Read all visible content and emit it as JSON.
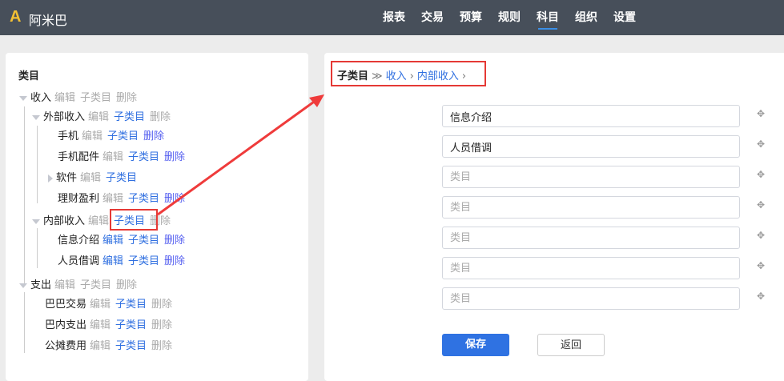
{
  "header": {
    "logo": "A",
    "brand": "阿米巴",
    "nav": [
      "报表",
      "交易",
      "预算",
      "规则",
      "科目",
      "组织",
      "设置"
    ],
    "active": "科目"
  },
  "left": {
    "title": "类目",
    "rows": [
      {
        "name": "收入",
        "level": 0,
        "toggle": "down",
        "actions": [
          [
            "编辑",
            "g"
          ],
          [
            "子类目",
            "g"
          ],
          [
            "删除",
            "g"
          ]
        ]
      },
      {
        "name": "外部收入",
        "level": 1,
        "toggle": "down",
        "actions": [
          [
            "编辑",
            "g"
          ],
          [
            "子类目",
            "b"
          ],
          [
            "删除",
            "g"
          ]
        ]
      },
      {
        "name": "手机",
        "level": 2,
        "actions": [
          [
            "编辑",
            "g"
          ],
          [
            "子类目",
            "b"
          ],
          [
            "删除",
            "p"
          ]
        ]
      },
      {
        "name": "手机配件",
        "level": 2,
        "actions": [
          [
            "编辑",
            "g"
          ],
          [
            "子类目",
            "b"
          ],
          [
            "删除",
            "p"
          ]
        ]
      },
      {
        "name": "软件",
        "level": 2,
        "toggle": "right",
        "actions": [
          [
            "编辑",
            "g"
          ],
          [
            "子类目",
            "b"
          ]
        ]
      },
      {
        "name": "理财盈利",
        "level": 2,
        "actions": [
          [
            "编辑",
            "g"
          ],
          [
            "子类目",
            "b"
          ],
          [
            "删除",
            "p"
          ]
        ]
      },
      {
        "name": "内部收入",
        "level": 1,
        "toggle": "down",
        "actions": [
          [
            "编辑",
            "g"
          ],
          [
            "子类目",
            "b"
          ],
          [
            "删除",
            "g"
          ]
        ]
      },
      {
        "name": "信息介绍",
        "level": 2,
        "actions": [
          [
            "编辑",
            "b"
          ],
          [
            "子类目",
            "b"
          ],
          [
            "删除",
            "p"
          ]
        ]
      },
      {
        "name": "人员借调",
        "level": 2,
        "actions": [
          [
            "编辑",
            "b"
          ],
          [
            "子类目",
            "b"
          ],
          [
            "删除",
            "p"
          ]
        ]
      },
      {
        "name": "支出",
        "level": 0,
        "toggle": "down",
        "actions": [
          [
            "编辑",
            "g"
          ],
          [
            "子类目",
            "g"
          ],
          [
            "删除",
            "g"
          ]
        ]
      },
      {
        "name": "巴巴交易",
        "level": 1,
        "actions": [
          [
            "编辑",
            "g"
          ],
          [
            "子类目",
            "b"
          ],
          [
            "删除",
            "g"
          ]
        ]
      },
      {
        "name": "巴内支出",
        "level": 1,
        "actions": [
          [
            "编辑",
            "g"
          ],
          [
            "子类目",
            "b"
          ],
          [
            "删除",
            "g"
          ]
        ]
      },
      {
        "name": "公摊费用",
        "level": 1,
        "actions": [
          [
            "编辑",
            "g"
          ],
          [
            "子类目",
            "b"
          ],
          [
            "删除",
            "g"
          ]
        ]
      }
    ]
  },
  "right": {
    "breadcrumb": {
      "title": "子类目",
      "sep": "≫",
      "items": [
        "收入",
        "内部收入"
      ],
      "chev": "›"
    },
    "inputs": [
      {
        "value": "信息介绍",
        "placeholder": "类目"
      },
      {
        "value": "人员借调",
        "placeholder": "类目"
      },
      {
        "value": "",
        "placeholder": "类目"
      },
      {
        "value": "",
        "placeholder": "类目"
      },
      {
        "value": "",
        "placeholder": "类目"
      },
      {
        "value": "",
        "placeholder": "类目"
      },
      {
        "value": "",
        "placeholder": "类目"
      }
    ],
    "move_icon": "✥",
    "save": "保存",
    "back": "返回"
  },
  "colors": {
    "header": "#474f5a",
    "link": "#2f6fe0",
    "delete": "#5660f0",
    "disabled": "#aaaaaa",
    "annotation": "#e53935"
  }
}
